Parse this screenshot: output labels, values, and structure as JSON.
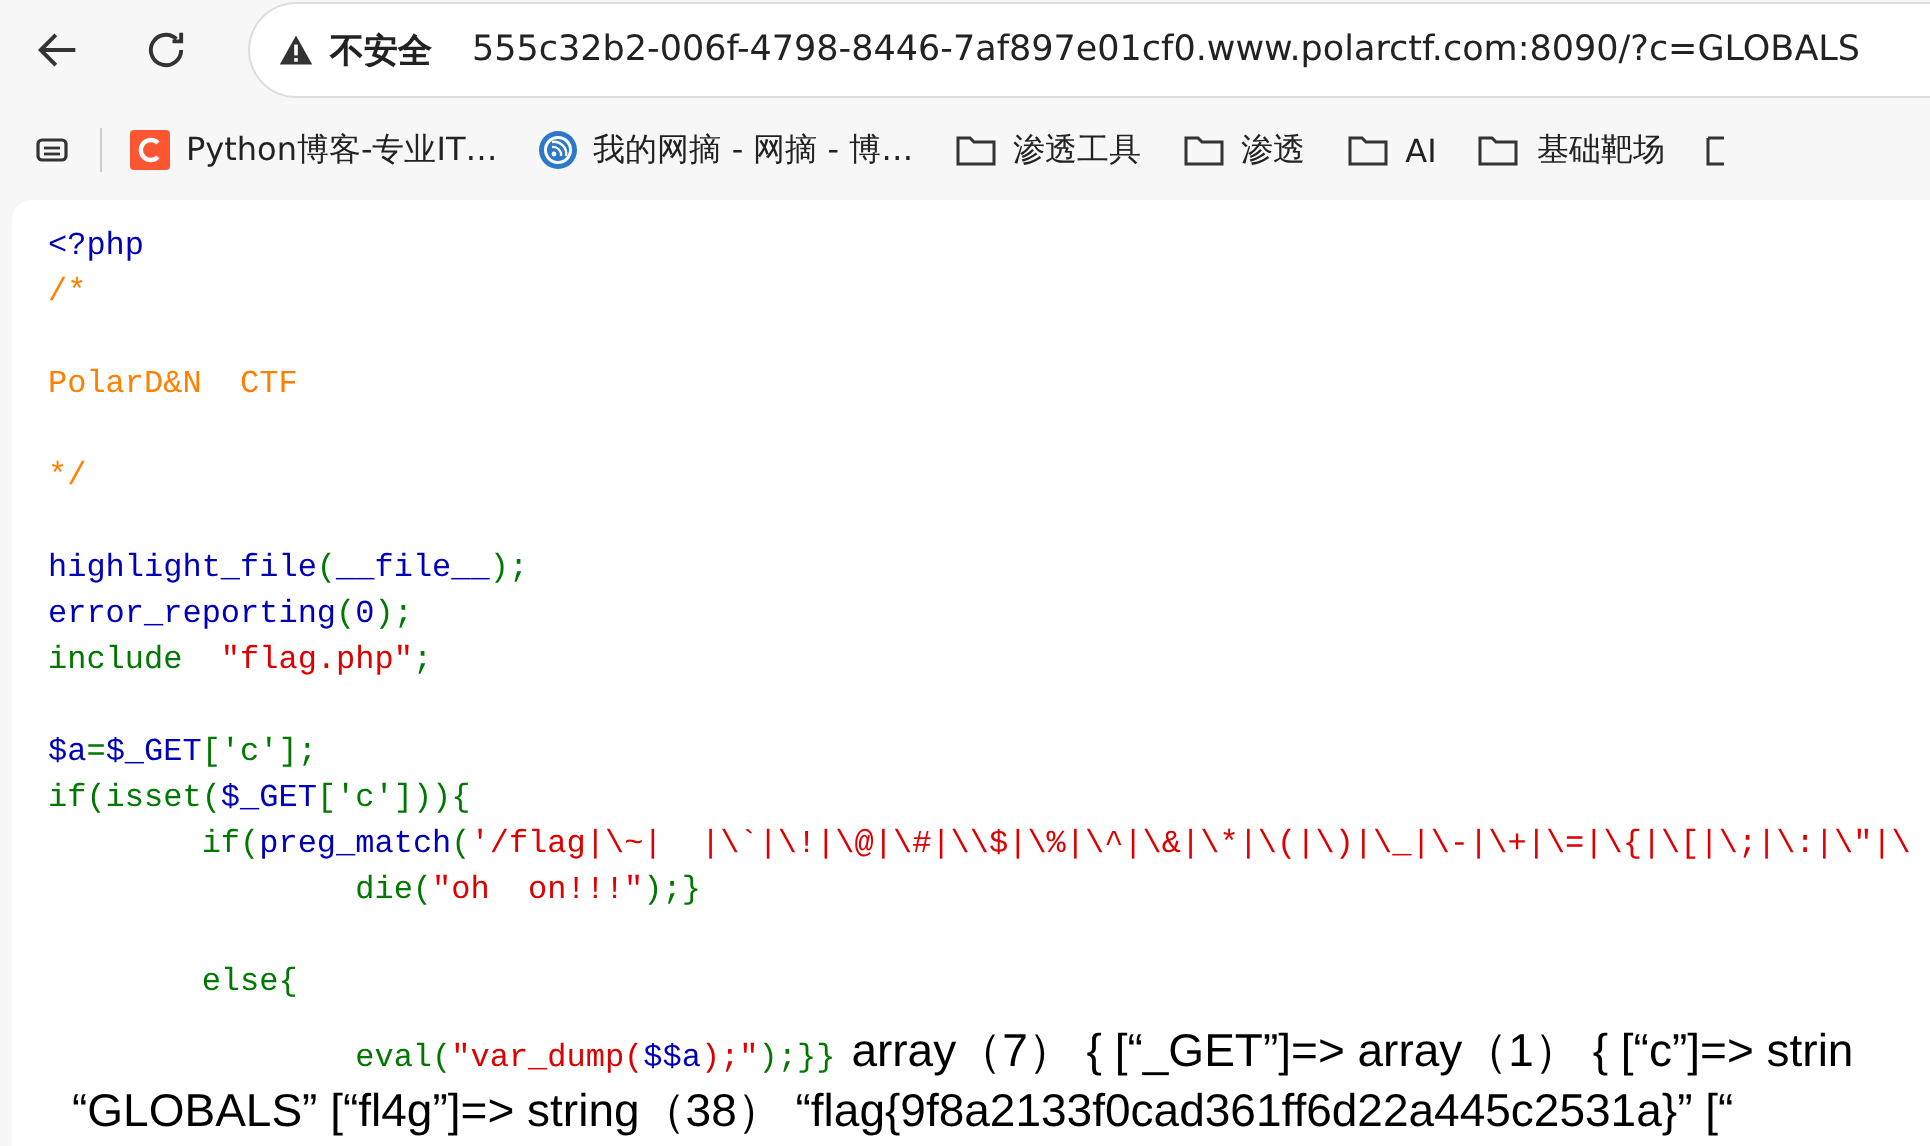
{
  "toolbar": {
    "security_label": "不安全",
    "url": "555c32b2-006f-4798-8446-7af897e01cf0.www.polarctf.com:8090/?c=GLOBALS"
  },
  "bookmarks": [
    {
      "kind": "site-c",
      "label": "Python博客-专业IT…"
    },
    {
      "kind": "site-rss",
      "label": "我的网摘 - 网摘 - 博…"
    },
    {
      "kind": "folder",
      "label": "渗透工具"
    },
    {
      "kind": "folder",
      "label": "渗透"
    },
    {
      "kind": "folder",
      "label": "AI"
    },
    {
      "kind": "folder",
      "label": "基础靶场"
    }
  ],
  "code": {
    "lines": [
      [
        {
          "kind": "default",
          "text": "<?php"
        }
      ],
      [
        {
          "kind": "comment",
          "text": "/*"
        }
      ],
      {
        "kind": "blank"
      },
      [
        {
          "kind": "comment",
          "text": "PolarD&N  CTF"
        }
      ],
      {
        "kind": "blank"
      },
      [
        {
          "kind": "comment",
          "text": "*/"
        }
      ],
      {
        "kind": "blank"
      },
      [
        {
          "kind": "default",
          "text": "highlight_file"
        },
        {
          "kind": "keyword",
          "text": "("
        },
        {
          "kind": "default",
          "text": "__file__"
        },
        {
          "kind": "keyword",
          "text": ");"
        }
      ],
      [
        {
          "kind": "default",
          "text": "error_reporting"
        },
        {
          "kind": "keyword",
          "text": "("
        },
        {
          "kind": "default",
          "text": "0"
        },
        {
          "kind": "keyword",
          "text": ");"
        }
      ],
      [
        {
          "kind": "keyword",
          "text": "include  "
        },
        {
          "kind": "string",
          "text": "\"flag.php\""
        },
        {
          "kind": "keyword",
          "text": ";"
        }
      ],
      {
        "kind": "blank"
      },
      [
        {
          "kind": "default",
          "text": "$a"
        },
        {
          "kind": "keyword",
          "text": "="
        },
        {
          "kind": "default",
          "text": "$_GET"
        },
        {
          "kind": "keyword",
          "text": "['c'];"
        }
      ],
      [
        {
          "kind": "keyword",
          "text": "if(isset("
        },
        {
          "kind": "default",
          "text": "$_GET"
        },
        {
          "kind": "keyword",
          "text": "['c'])){"
        }
      ],
      [
        {
          "kind": "keyword",
          "text": "\t\tif("
        },
        {
          "kind": "default",
          "text": "preg_match"
        },
        {
          "kind": "keyword",
          "text": "("
        },
        {
          "kind": "string",
          "text": "'/flag|\\~|  |\\`|\\!|\\@|\\#|\\\\$|\\%|\\^|\\&|\\*|\\(|\\)|\\_|\\-|\\+|\\=|\\{|\\[|\\;|\\:|\\\"|\\"
        }
      ],
      [
        {
          "kind": "keyword",
          "text": "\t\t\t\tdie("
        },
        {
          "kind": "string",
          "text": "\"oh  on!!!\""
        },
        {
          "kind": "keyword",
          "text": ");}"
        }
      ],
      {
        "kind": "blank"
      },
      [
        {
          "kind": "keyword",
          "text": "\t\telse{"
        }
      ],
      [
        {
          "kind": "keyword",
          "text": "\t\t\t\teval("
        },
        {
          "kind": "string",
          "text": "\"var_dump("
        },
        {
          "kind": "default",
          "text": "$$a"
        },
        {
          "kind": "string",
          "text": ");\""
        },
        {
          "kind": "keyword",
          "text": ");}}"
        }
      ]
    ]
  },
  "output": [
    "array（7） { [“_GET”]=> array（1） { [“c”]=> strin",
    "“GLOBALS” [“fl4g”]=> string（38） “flag{9f8a2133f0cad361ff6d22a445c2531a}” [“"
  ]
}
